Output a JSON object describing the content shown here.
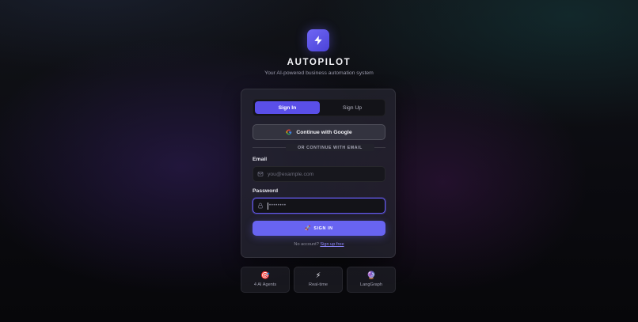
{
  "brand": {
    "title": "AUTOPILOT",
    "subtitle": "Your AI-powered business automation system",
    "logo_icon": "lightning-bolt-icon",
    "accent_color": "#5a4fe8"
  },
  "auth": {
    "tabs": [
      {
        "label": "Sign In",
        "active": true
      },
      {
        "label": "Sign Up",
        "active": false
      }
    ],
    "google_button": "Continue with Google",
    "divider_text": "OR CONTINUE WITH EMAIL",
    "email": {
      "label": "Email",
      "placeholder": "you@example.com",
      "value": ""
    },
    "password": {
      "label": "Password",
      "mask": "••••••••",
      "value": ""
    },
    "submit": {
      "icon": "🚀",
      "label": "SIGN IN"
    },
    "footer": {
      "prompt": "No account?",
      "link": "Sign up free"
    }
  },
  "features": [
    {
      "icon": "🎯",
      "label": "4 AI Agents"
    },
    {
      "icon": "⚡",
      "label": "Real-time"
    },
    {
      "icon": "🔮",
      "label": "LangGraph"
    }
  ]
}
